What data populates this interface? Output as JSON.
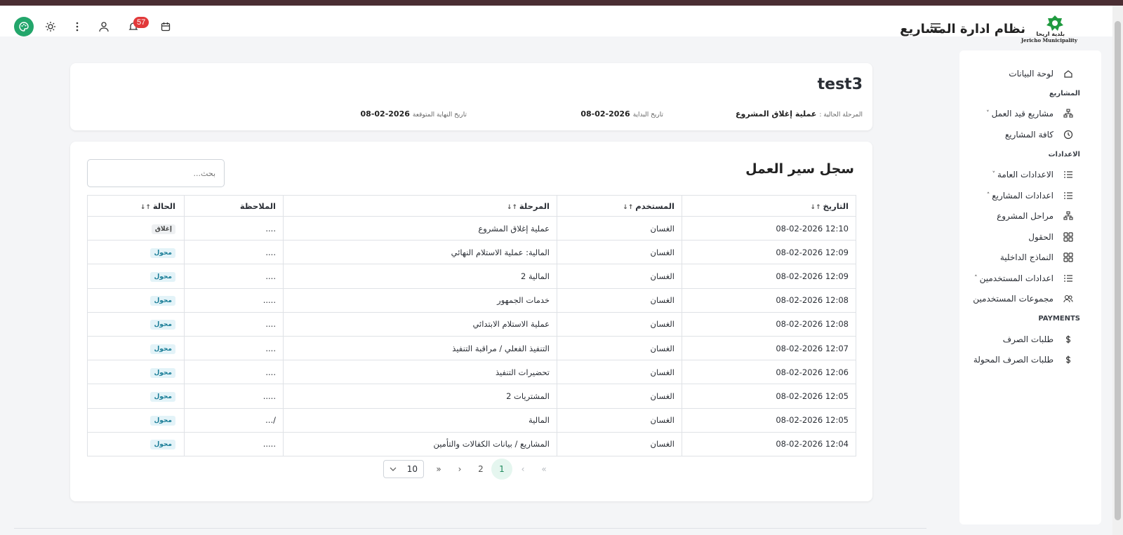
{
  "app": {
    "title": "نظام ادارة المشاريع",
    "logo_ar": "بلدية اريحا",
    "logo_en": "Jericho Municipality"
  },
  "topbar": {
    "notification_count": "57",
    "icons": [
      "palette-icon",
      "sun-icon",
      "more-vertical-icon",
      "user-icon",
      "bell-icon",
      "calendar-icon",
      "hamburger-menu-icon"
    ],
    "accent": "#23a66b",
    "badge_color": "#e2393a"
  },
  "sidebar": {
    "items": [
      {
        "type": "item",
        "label": "لوحة البيانات",
        "icon": "home-icon"
      },
      {
        "type": "section",
        "label": "المشاريع"
      },
      {
        "type": "item",
        "label": "مشاريع قيد العمل",
        "icon": "hierarchy-icon",
        "chevron": "˅"
      },
      {
        "type": "item",
        "label": "كافة المشاريع",
        "icon": "clock-icon"
      },
      {
        "type": "section",
        "label": "الاعدادات"
      },
      {
        "type": "item",
        "label": "الاعدادات العامة",
        "icon": "list-icon",
        "chevron": "˅"
      },
      {
        "type": "item",
        "label": "اعدادات المشاريع",
        "icon": "list-icon",
        "chevron": "˄"
      },
      {
        "type": "item",
        "label": "مراحل المشروع",
        "icon": "hierarchy-icon"
      },
      {
        "type": "item",
        "label": "الحقول",
        "icon": "grid-icon"
      },
      {
        "type": "item",
        "label": "النماذج الداخلية",
        "icon": "grid-icon"
      },
      {
        "type": "item",
        "label": "اعدادات المستخدمين",
        "icon": "list-icon",
        "chevron": "˄"
      },
      {
        "type": "item",
        "label": "مجموعات المستخدمين",
        "icon": "users-icon"
      },
      {
        "type": "section",
        "label": "PAYMENTS"
      },
      {
        "type": "item",
        "label": "طلبات الصرف",
        "icon": "dollar-icon"
      },
      {
        "type": "item",
        "label": "طلبات الصرف المحولة",
        "icon": "dollar-icon"
      }
    ]
  },
  "project": {
    "name": "test3",
    "current_stage_label": "المرحلة الحالية :",
    "current_stage_value": "عملية إغلاق المشروع",
    "start_label": "تاريخ البداية",
    "start_value": "08-02-2026",
    "end_label": "تاريخ النهاية المتوقعة",
    "end_value": "08-02-2026"
  },
  "worklog": {
    "title": "سجل سير العمل",
    "search_placeholder": "بحث...",
    "columns": {
      "date": "التاريخ",
      "user": "المستخدم",
      "stage": "المرحلة",
      "note": "الملاحظة",
      "status": "الحالة"
    },
    "sort_glyph": "↑↓",
    "rows": [
      {
        "date": "08-02-2026 12:10",
        "user": "الغسان",
        "stage": "عملية إغلاق المشروع",
        "note": "....",
        "status": "إغلاق",
        "kind": "closed"
      },
      {
        "date": "08-02-2026 12:09",
        "user": "الغسان",
        "stage": "المالية: عملية الاستلام النهائي",
        "note": "....",
        "status": "محول",
        "kind": "moved"
      },
      {
        "date": "08-02-2026 12:09",
        "user": "الغسان",
        "stage": "المالية 2",
        "note": "....",
        "status": "محول",
        "kind": "moved"
      },
      {
        "date": "08-02-2026 12:08",
        "user": "الغسان",
        "stage": "خدمات الجمهور",
        "note": ".....",
        "status": "محول",
        "kind": "moved"
      },
      {
        "date": "08-02-2026 12:08",
        "user": "الغسان",
        "stage": "عملية الاستلام الابتدائي",
        "note": "....",
        "status": "محول",
        "kind": "moved"
      },
      {
        "date": "08-02-2026 12:07",
        "user": "الغسان",
        "stage": "التنفيذ الفعلي / مراقبة التنفيذ",
        "note": "....",
        "status": "محول",
        "kind": "moved"
      },
      {
        "date": "08-02-2026 12:06",
        "user": "الغسان",
        "stage": "تحضيرات التنفيذ",
        "note": "....",
        "status": "محول",
        "kind": "moved"
      },
      {
        "date": "08-02-2026 12:05",
        "user": "الغسان",
        "stage": "المشتريات 2",
        "note": ".....",
        "status": "محول",
        "kind": "moved"
      },
      {
        "date": "08-02-2026 12:05",
        "user": "الغسان",
        "stage": "المالية",
        "note": "/...",
        "status": "محول",
        "kind": "moved"
      },
      {
        "date": "08-02-2026 12:04",
        "user": "الغسان",
        "stage": "المشاريع / بيانات الكفالات والتأمين",
        "note": ".....",
        "status": "محول",
        "kind": "moved"
      }
    ]
  },
  "pagination": {
    "page_size": "10",
    "first": "«",
    "prev": "‹",
    "pages": [
      "1",
      "2"
    ],
    "current": "1",
    "next": "›",
    "last": "»"
  }
}
